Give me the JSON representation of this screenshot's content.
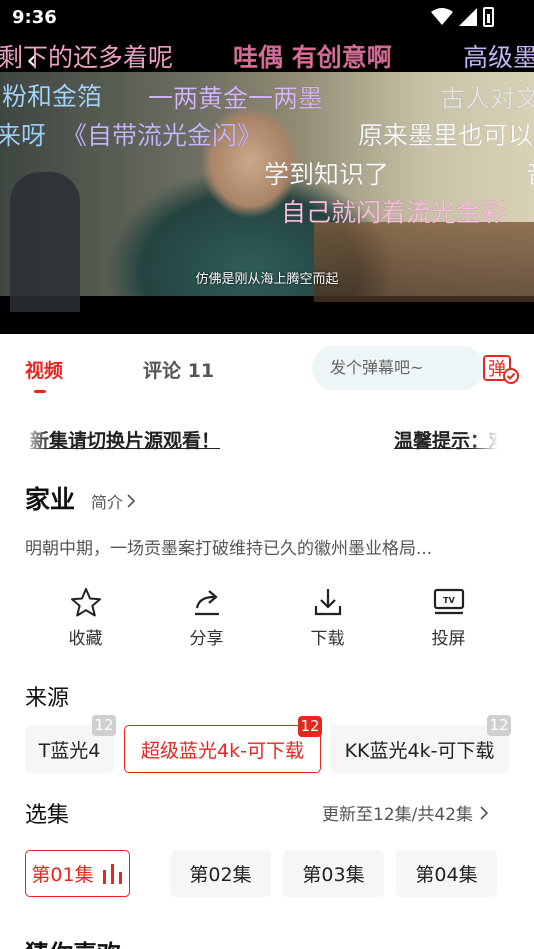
{
  "status_bar": {
    "time": "9:36"
  },
  "video": {
    "danmu": [
      "剩下的还多着呢",
      "哇偶 有创意啊",
      "高级墨",
      "粉和金箔",
      "一两黄金一两墨",
      "古人对文",
      "来呀",
      "《自带流光金闪》",
      "原来墨里也可以",
      "学到知识了",
      "音",
      "自己就闪着流光金彩"
    ],
    "danmu_colors": [
      "#f2a4c8",
      "#9fd3ff",
      "#c9b6ff",
      "#ffc8a0",
      "#ffffff"
    ],
    "subtitle": "仿佛是刚从海上腾空而起"
  },
  "tabs": {
    "video": "视频",
    "comments": "评论 11",
    "danmu_placeholder": "发个弹幕吧~",
    "danmu_button": "弹"
  },
  "notice": {
    "line1": "新集请切换片源观看！",
    "line2": "温馨提示：欢"
  },
  "show": {
    "title": "家业",
    "intro_link": "简介",
    "description": "明朝中期，一场贡墨案打破维持已久的徽州墨业格局..."
  },
  "actions": [
    {
      "label": "收藏",
      "icon": "star-icon"
    },
    {
      "label": "分享",
      "icon": "share-icon"
    },
    {
      "label": "下载",
      "icon": "download-icon"
    },
    {
      "label": "投屏",
      "icon": "tv-cast-icon"
    }
  ],
  "source": {
    "label": "来源",
    "items": [
      {
        "name": "T蓝光4",
        "count": "12",
        "active": false
      },
      {
        "name": "超级蓝光4k-可下载",
        "count": "12",
        "active": true
      },
      {
        "name": "KK蓝光4k-可下载",
        "count": "12",
        "active": false
      }
    ]
  },
  "episodes": {
    "label": "选集",
    "update": "更新至12集/共42集",
    "items": [
      {
        "name": "第01集",
        "active": true
      },
      {
        "name": "第02集",
        "active": false
      },
      {
        "name": "第03集",
        "active": false
      },
      {
        "name": "第04集",
        "active": false
      }
    ]
  },
  "recommend": {
    "label": "猜你喜欢"
  },
  "colors": {
    "accent": "#e8261f"
  }
}
